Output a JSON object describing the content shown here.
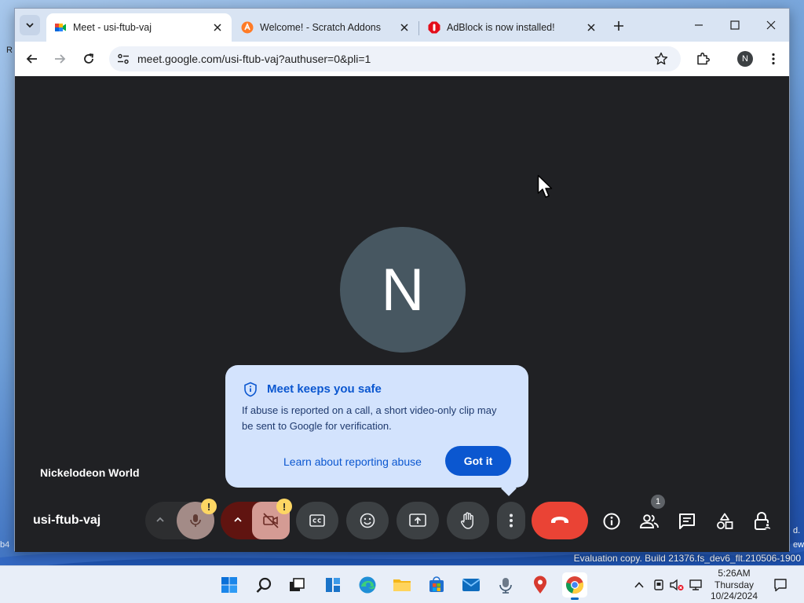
{
  "browser": {
    "tabs": [
      {
        "title": "Meet - usi-ftub-vaj",
        "active": true
      },
      {
        "title": "Welcome! - Scratch Addons",
        "active": false
      },
      {
        "title": "AdBlock is now installed!",
        "active": false
      }
    ],
    "url": "meet.google.com/usi-ftub-vaj?authuser=0&pli=1",
    "profile_initial": "N"
  },
  "meet": {
    "avatar_letter": "N",
    "participant_name": "Nickelodeon World",
    "meeting_code": "usi-ftub-vaj",
    "people_count": "1",
    "mic_warning": "!",
    "camera_warning": "!",
    "end_call_color": "#ea4335",
    "popup": {
      "title": "Meet keeps you safe",
      "body": "If abuse is reported on a call, a short video-only clip may be sent to Google for verification.",
      "link": "Learn about reporting abuse",
      "button": "Got it"
    }
  },
  "desktop": {
    "evaluation_text": "Evaluation copy. Build 21376.fs_dev6_flt.210506-1900",
    "left_fragment": "b4",
    "right_fragment": "d.",
    "right_fragment2": "ew",
    "top_fragment": "R"
  },
  "taskbar": {
    "time": "5:26AM",
    "day": "Thursday",
    "date": "10/24/2024"
  }
}
